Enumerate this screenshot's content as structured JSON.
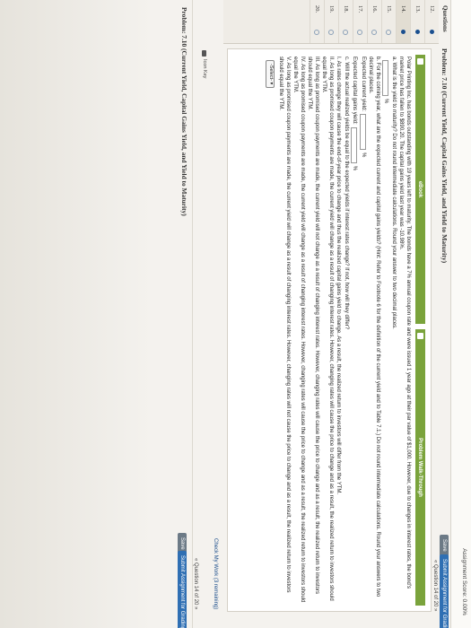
{
  "header": {
    "assignment_score": "Assignment Score: 0.00%",
    "questions_label": "Questions",
    "problem_title": "Problem: 7.10 (Current Yield, Capital Gains Yield, and Yield to Maturity)",
    "save_label": "Save",
    "submit_label": "Submit Assignment for Grading",
    "question_nav": "« Question 14 of 20 »"
  },
  "sidebar": {
    "items": [
      {
        "num": "12.",
        "state": "filled"
      },
      {
        "num": "13.",
        "state": "filled"
      },
      {
        "num": "14.",
        "state": "filled"
      },
      {
        "num": "15.",
        "state": "empty"
      },
      {
        "num": "16.",
        "state": "empty"
      },
      {
        "num": "17.",
        "state": "empty"
      },
      {
        "num": "18.",
        "state": "empty"
      },
      {
        "num": "19.",
        "state": "empty"
      },
      {
        "num": "20.",
        "state": "empty"
      }
    ]
  },
  "tabs": {
    "ebook": "eBook",
    "walkthrough": "Problem Walk-Through"
  },
  "problem": {
    "intro": "Polar Printing Inc. has bonds outstanding with 19 years left to maturity. The bonds have a 7% annual coupon rate and were issued 1 year ago at their par value of $1,000. However, due to changes in interest rates, the bond's market price has fallen to $890.20. The capital gains yield last year was -10.98%.",
    "a": "a. What is the yield to maturity? Do not round intermediate calculations. Round your answer to two decimal places.",
    "pct": "%",
    "b": "b. For the coming year, what are the expected current and capital gains yields? (Hint: Refer to Footnote 6 for the definition of the current yield and to Table 7.1.) Do not round intermediate calculations. Round your answers to two decimal places.",
    "current_yield_label": "Expected current yield:",
    "capital_gains_label": "Expected capital gains yield:",
    "c": "c. Will the actual realized yields be equal to the expected yields if interest rates change? If not, how will they differ?",
    "options": [
      "I. As rates change they will cause the end-of-year price to change and thus the realized capital gains yield to change. As a result, the realized return to investors will differ from the YTM.",
      "II. As long as promised coupon payments are made, the current yield will change as a result of changing interest rates. However, changing rates will cause the price to change and as a result, the realized return to investors should equal the YTM.",
      "III. As long as promised coupon payments are made, the current yield will not change as a result of changing interest rates. However, changing rates will cause the price to change and as a result, the realized return to investors should equal the YTM.",
      "IV. As long as promised coupon payments are made, the current yield will change as a result of changing interest rates. However, changing rates will cause the price to change and as a result, the realized return to investors should equal the YTM.",
      "V. As long as promised coupon payments are made, the current yield will change as a result of changing interest rates. However, changing rates will not cause the price to change and as a result, the realized return to investors should equal the YTM."
    ],
    "select_label": "-Select-"
  },
  "footer": {
    "check_work": "Check My Work (3 remaining)",
    "icon_key": "Icon Key",
    "problem_title": "Problem: 7.10 (Current Yield, Capital Gains Yield, and Yield to Maturity)",
    "save_label": "Save",
    "submit_label": "Submit Assignment for Grading",
    "question_nav": "« Question 14 of 20 »"
  }
}
